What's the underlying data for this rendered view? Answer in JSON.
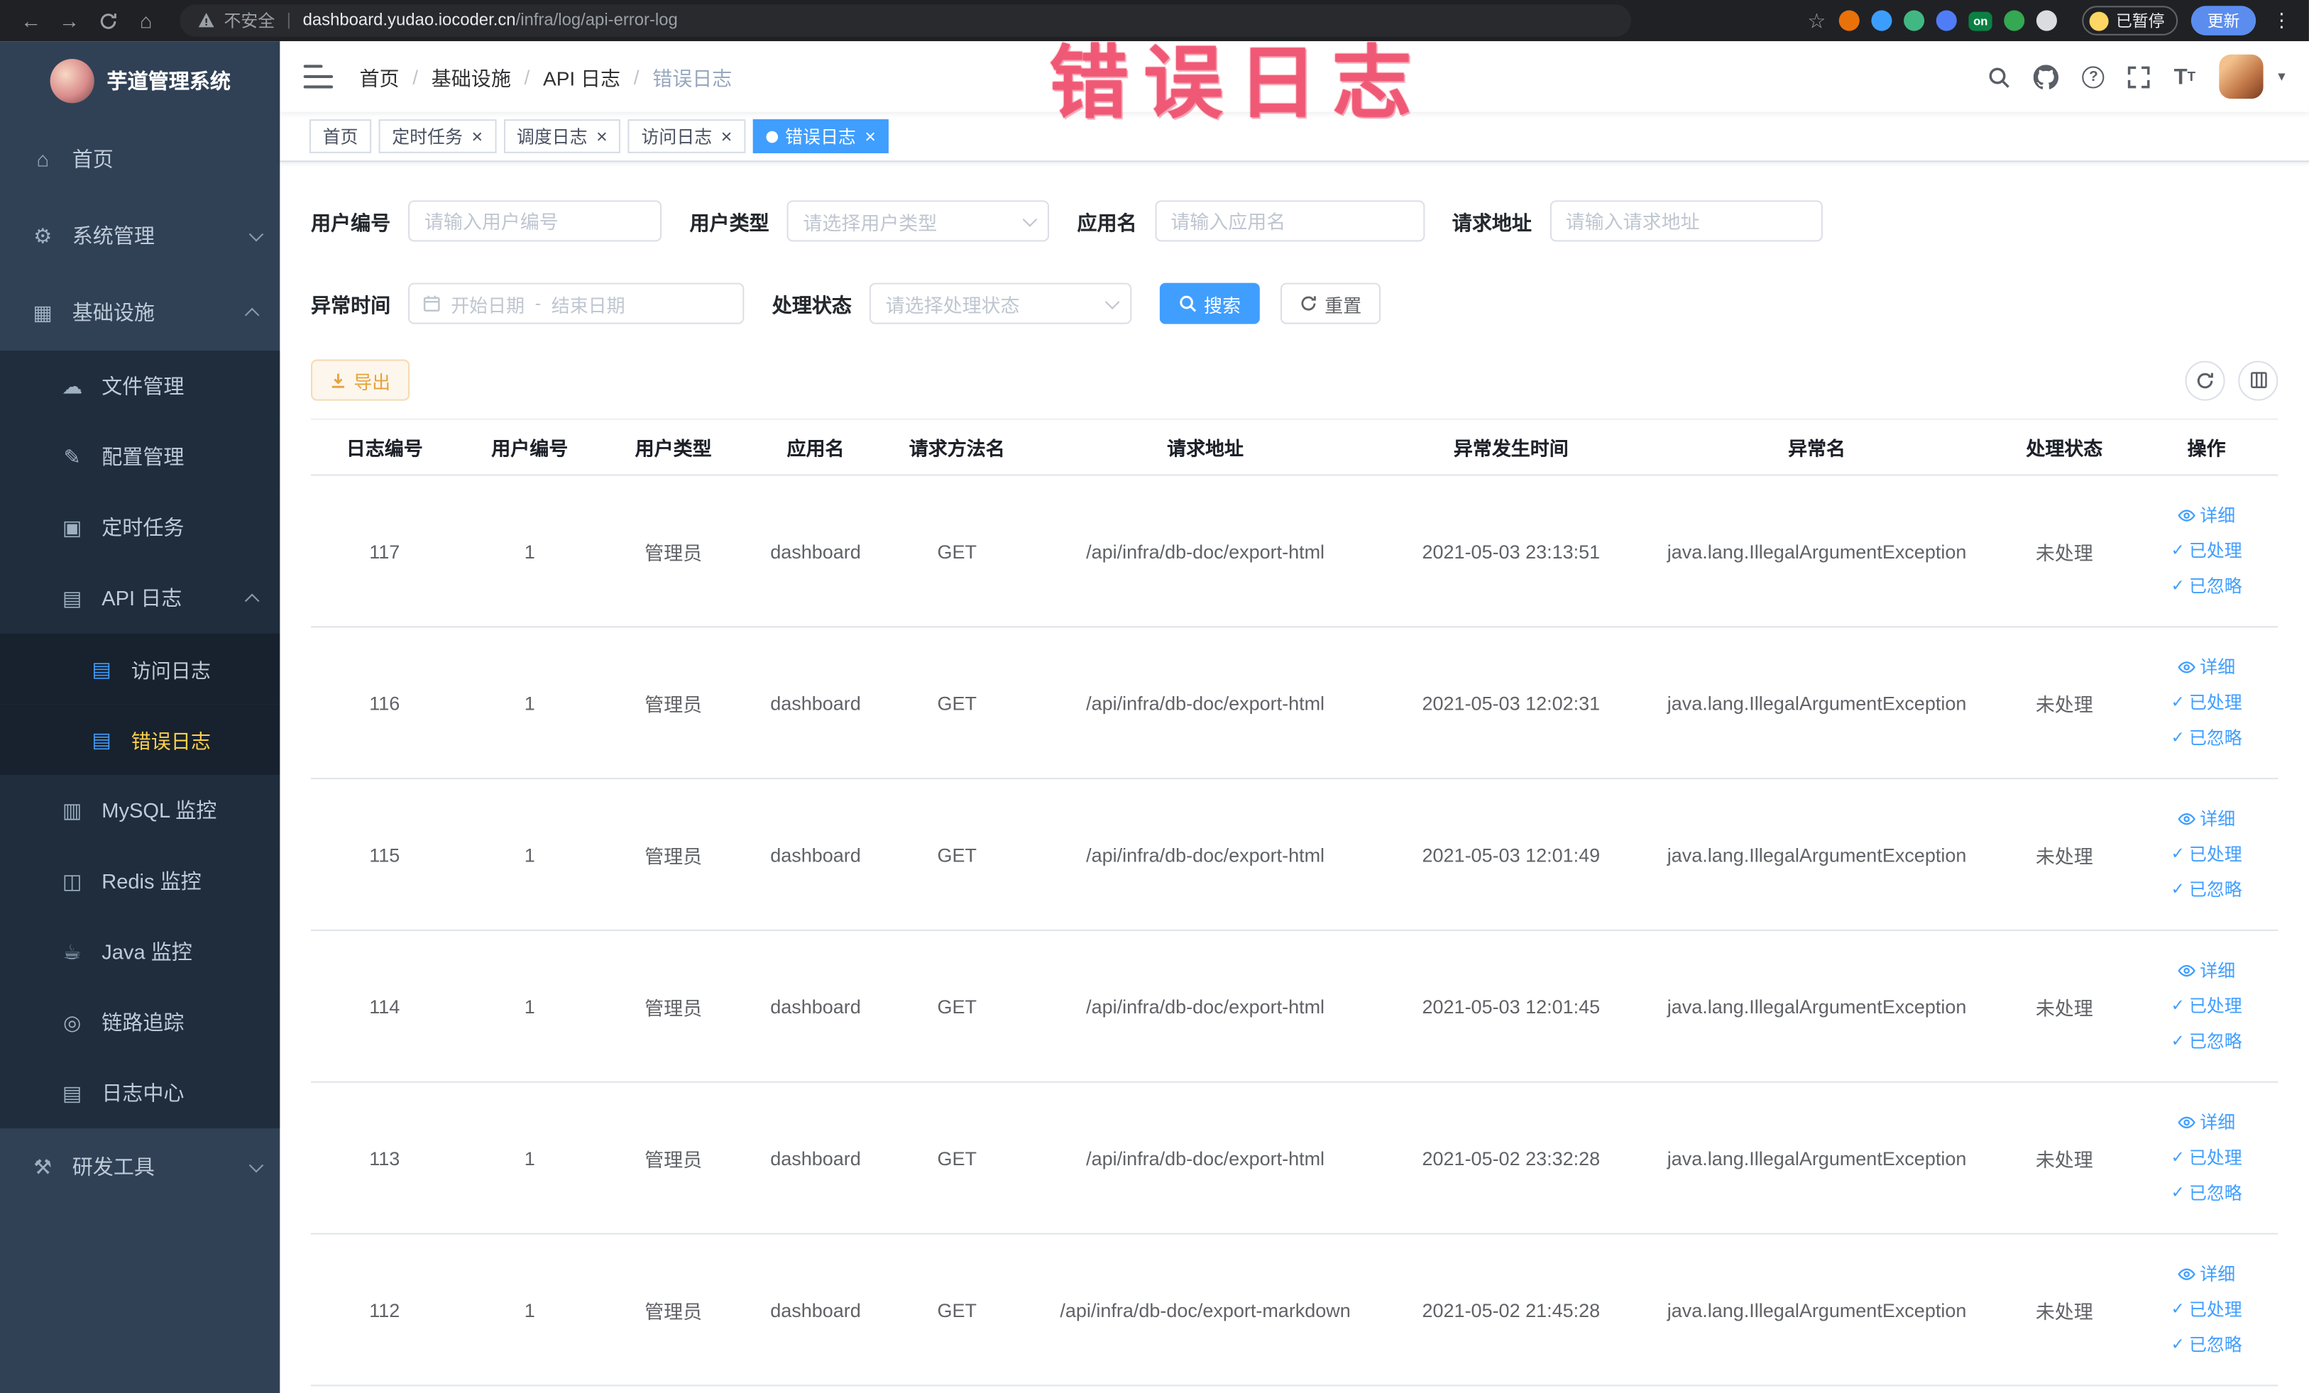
{
  "browser": {
    "security_label": "不安全",
    "url_host": "dashboard.yudao.iocoder.cn",
    "url_path": "/infra/log/api-error-log",
    "paused_badge": "已暂停",
    "update_button": "更新",
    "extensions": [
      {
        "name": "extension-orange-circle",
        "color": "#e8710a"
      },
      {
        "name": "extension-blue-circle",
        "color": "#3b9eff"
      },
      {
        "name": "extension-vue-devtools",
        "color": "#41b883"
      },
      {
        "name": "extension-blue-grid",
        "color": "#4f7df7"
      },
      {
        "name": "extension-on-toggle",
        "color": "#0b8043",
        "text": "on"
      },
      {
        "name": "extension-green-leaf",
        "color": "#34a853"
      },
      {
        "name": "extension-light-circle",
        "color": "#dadce0"
      }
    ]
  },
  "annotation": {
    "text": "错误日志"
  },
  "sidebar": {
    "title": "芋道管理系统",
    "menu": [
      {
        "key": "home",
        "label": "首页",
        "icon": "home-icon",
        "level": 1
      },
      {
        "key": "system-management",
        "label": "系统管理",
        "icon": "gear-icon",
        "level": 1,
        "chevron": "down"
      },
      {
        "key": "infrastructure",
        "label": "基础设施",
        "icon": "infra-icon",
        "level": 1,
        "chevron": "up"
      },
      {
        "key": "file-management",
        "label": "文件管理",
        "icon": "file-icon",
        "level": 2
      },
      {
        "key": "config-management",
        "label": "配置管理",
        "icon": "config-icon",
        "level": 2
      },
      {
        "key": "scheduled-task",
        "label": "定时任务",
        "icon": "task-icon",
        "level": 2
      },
      {
        "key": "api-log",
        "label": "API 日志",
        "icon": "api-log-icon",
        "level": 2,
        "chevron": "up"
      },
      {
        "key": "access-log",
        "label": "访问日志",
        "icon": "doc-icon",
        "level": 3
      },
      {
        "key": "error-log",
        "label": "错误日志",
        "icon": "doc-icon",
        "level": 3,
        "active": true
      },
      {
        "key": "mysql-monitor",
        "label": "MySQL 监控",
        "icon": "mysql-icon",
        "level": 2
      },
      {
        "key": "redis-monitor",
        "label": "Redis 监控",
        "icon": "redis-icon",
        "level": 2
      },
      {
        "key": "java-monitor",
        "label": "Java 监控",
        "icon": "java-icon",
        "level": 2
      },
      {
        "key": "trace",
        "label": "链路追踪",
        "icon": "trace-icon",
        "level": 2
      },
      {
        "key": "log-center",
        "label": "日志中心",
        "icon": "log-center-icon",
        "level": 2
      },
      {
        "key": "dev-tools",
        "label": "研发工具",
        "icon": "devtools-icon",
        "level": 1,
        "chevron": "down"
      }
    ]
  },
  "navbar": {
    "breadcrumb": [
      "首页",
      "基础设施",
      "API 日志",
      "错误日志"
    ]
  },
  "tags_view": [
    {
      "key": "home",
      "label": "首页",
      "closable": false,
      "active": false
    },
    {
      "key": "scheduled-task",
      "label": "定时任务",
      "closable": true,
      "active": false
    },
    {
      "key": "schedule-log",
      "label": "调度日志",
      "closable": true,
      "active": false
    },
    {
      "key": "access-log",
      "label": "访问日志",
      "closable": true,
      "active": false
    },
    {
      "key": "error-log",
      "label": "错误日志",
      "closable": true,
      "active": true
    }
  ],
  "filters": {
    "user_id": {
      "label": "用户编号",
      "placeholder": "请输入用户编号"
    },
    "user_type": {
      "label": "用户类型",
      "placeholder": "请选择用户类型"
    },
    "app_name": {
      "label": "应用名",
      "placeholder": "请输入应用名"
    },
    "request_url": {
      "label": "请求地址",
      "placeholder": "请输入请求地址"
    },
    "exception_time": {
      "label": "异常时间",
      "start_placeholder": "开始日期",
      "separator": "-",
      "end_placeholder": "结束日期"
    },
    "process_status": {
      "label": "处理状态",
      "placeholder": "请选择处理状态"
    },
    "search_button": "搜索",
    "reset_button": "重置"
  },
  "toolbar": {
    "export_button": "导出"
  },
  "table": {
    "columns": [
      "日志编号",
      "用户编号",
      "用户类型",
      "应用名",
      "请求方法名",
      "请求地址",
      "异常发生时间",
      "异常名",
      "处理状态",
      "操作"
    ],
    "fields": [
      "id",
      "user_id",
      "user_type",
      "app",
      "method",
      "url",
      "time",
      "exception",
      "status"
    ],
    "row_actions": [
      {
        "key": "detail",
        "label": "详细",
        "icon": "eye-icon"
      },
      {
        "key": "processed",
        "label": "已处理",
        "icon": "check-icon"
      },
      {
        "key": "ignored",
        "label": "已忽略",
        "icon": "check-icon"
      }
    ],
    "rows": [
      {
        "id": "117",
        "user_id": "1",
        "user_type": "管理员",
        "app": "dashboard",
        "method": "GET",
        "url": "/api/infra/db-doc/export-html",
        "time": "2021-05-03 23:13:51",
        "exception": "java.lang.IllegalArgumentException",
        "status": "未处理"
      },
      {
        "id": "116",
        "user_id": "1",
        "user_type": "管理员",
        "app": "dashboard",
        "method": "GET",
        "url": "/api/infra/db-doc/export-html",
        "time": "2021-05-03 12:02:31",
        "exception": "java.lang.IllegalArgumentException",
        "status": "未处理"
      },
      {
        "id": "115",
        "user_id": "1",
        "user_type": "管理员",
        "app": "dashboard",
        "method": "GET",
        "url": "/api/infra/db-doc/export-html",
        "time": "2021-05-03 12:01:49",
        "exception": "java.lang.IllegalArgumentException",
        "status": "未处理"
      },
      {
        "id": "114",
        "user_id": "1",
        "user_type": "管理员",
        "app": "dashboard",
        "method": "GET",
        "url": "/api/infra/db-doc/export-html",
        "time": "2021-05-03 12:01:45",
        "exception": "java.lang.IllegalArgumentException",
        "status": "未处理"
      },
      {
        "id": "113",
        "user_id": "1",
        "user_type": "管理员",
        "app": "dashboard",
        "method": "GET",
        "url": "/api/infra/db-doc/export-html",
        "time": "2021-05-02 23:32:28",
        "exception": "java.lang.IllegalArgumentException",
        "status": "未处理"
      },
      {
        "id": "112",
        "user_id": "1",
        "user_type": "管理员",
        "app": "dashboard",
        "method": "GET",
        "url": "/api/infra/db-doc/export-markdown",
        "time": "2021-05-02 21:45:28",
        "exception": "java.lang.IllegalArgumentException",
        "status": "未处理"
      }
    ]
  },
  "theme": {
    "primary": "#409eff",
    "active_menu_color": "#ffd04b",
    "warning": "#e6a23c",
    "annotation_color": "#ef4363"
  }
}
